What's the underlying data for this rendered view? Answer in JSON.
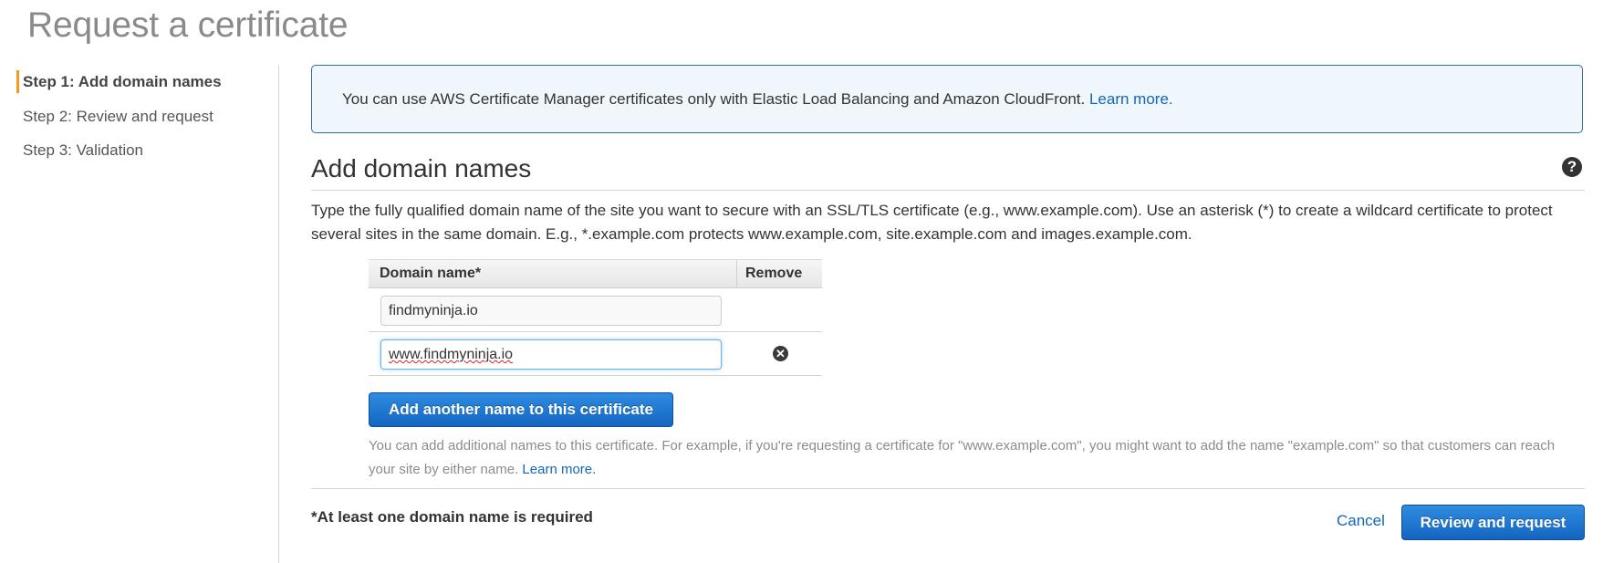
{
  "page": {
    "title": "Request a certificate"
  },
  "sidebar": {
    "steps": [
      {
        "label": "Step 1: Add domain names",
        "active": true
      },
      {
        "label": "Step 2: Review and request",
        "active": false
      },
      {
        "label": "Step 3: Validation",
        "active": false
      }
    ],
    "active_marker_color": "#f7981d"
  },
  "info_box": {
    "text": "You can use AWS Certificate Manager certificates only with Elastic Load Balancing and Amazon CloudFront. ",
    "link": "Learn more."
  },
  "section": {
    "heading": "Add domain names",
    "help_icon": "question-circle-icon",
    "help_glyph": "?",
    "description": "Type the fully qualified domain name of the site you want to secure with an SSL/TLS certificate (e.g., www.example.com). Use an asterisk (*) to create a wildcard certificate to protect several sites in the same domain. E.g., *.example.com protects www.example.com, site.example.com and images.example.com."
  },
  "table": {
    "headers": {
      "domain": "Domain name*",
      "remove": "Remove"
    },
    "rows": [
      {
        "value": "findmyninja.io",
        "removable": false,
        "focused": false
      },
      {
        "value": "www.findmyninja.io",
        "removable": true,
        "focused": true
      }
    ],
    "remove_glyph": "✕"
  },
  "add_button": {
    "label": "Add another name to this certificate"
  },
  "help_text": {
    "text": "You can add additional names to this certificate. For example, if you're requesting a certificate for \"www.example.com\", you might want to add the name \"example.com\" so that customers can reach your site by either name. ",
    "link": "Learn more."
  },
  "footer": {
    "required_note": "*At least one domain name is required",
    "cancel_label": "Cancel",
    "review_label": "Review and request"
  },
  "colors": {
    "primary_button": "#1f78d1",
    "link": "#1166bb",
    "info_bg": "#eff7fc",
    "info_border": "#2e6da4"
  }
}
